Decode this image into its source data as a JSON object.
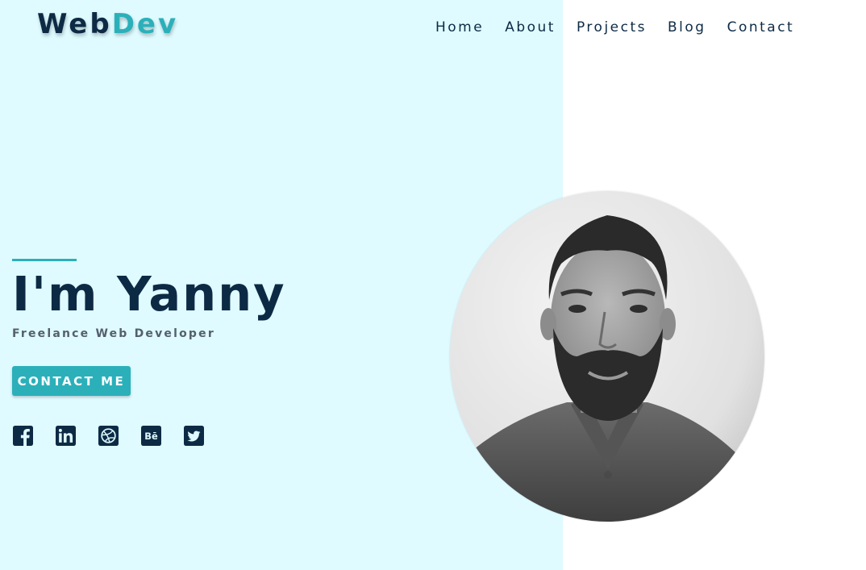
{
  "brand": {
    "part1": "Web",
    "part2": "Dev"
  },
  "nav": [
    {
      "label": "Home"
    },
    {
      "label": "About"
    },
    {
      "label": "Projects"
    },
    {
      "label": "Blog"
    },
    {
      "label": "Contact"
    }
  ],
  "hero": {
    "title": "I'm Yanny",
    "subtitle": "Freelance Web Developer",
    "cta_label": "CONTACT ME"
  },
  "social": [
    {
      "icon": "facebook-icon"
    },
    {
      "icon": "linkedin-icon"
    },
    {
      "icon": "dribbble-icon"
    },
    {
      "icon": "behance-icon",
      "text": "Bē"
    },
    {
      "icon": "twitter-icon"
    }
  ],
  "colors": {
    "panel_bg": "#dffbff",
    "accent": "#2bb0ba",
    "dark": "#0d2a45"
  }
}
